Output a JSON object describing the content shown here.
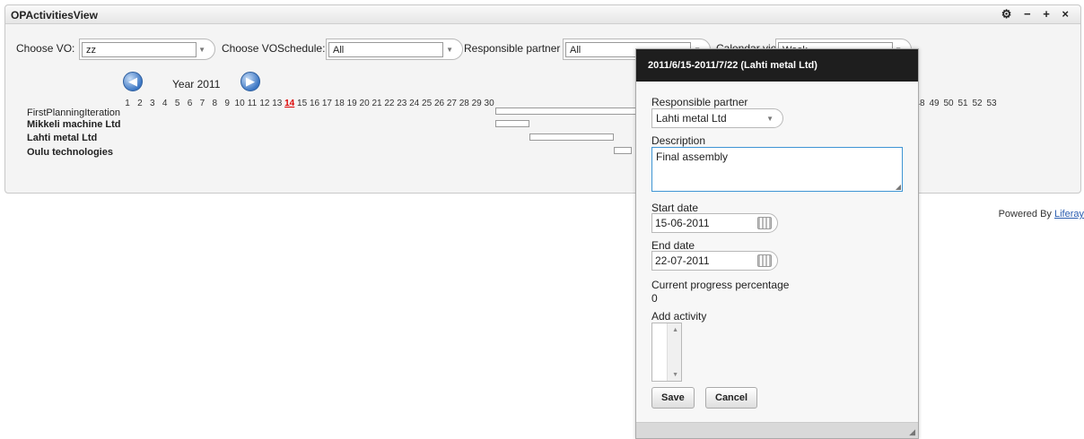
{
  "portlet": {
    "title": "OPActivitiesView",
    "controls": {
      "config": "⚙",
      "minimize": "−",
      "maximize": "+",
      "close": "×"
    }
  },
  "filters": {
    "vo": {
      "label": "Choose VO:",
      "value": "zz"
    },
    "schedule": {
      "label": "Choose VOSchedule:",
      "value": "All"
    },
    "partner": {
      "label": "Responsible partner",
      "value": "All"
    },
    "calendar": {
      "label": "Calendar view:",
      "value": "Week"
    }
  },
  "timeline": {
    "year_label": "Year 2011",
    "prev_label": "◀",
    "next_label": "▶",
    "current_week": 14,
    "weeks_left": [
      "1",
      "2",
      "3",
      "4",
      "5",
      "6",
      "7",
      "8",
      "9",
      "10",
      "11",
      "12",
      "13",
      "14",
      "15",
      "16",
      "17",
      "18",
      "19",
      "20",
      "21",
      "22",
      "23",
      "24",
      "25",
      "26",
      "27",
      "28",
      "29",
      "30"
    ],
    "weeks_right": [
      "48",
      "49",
      "50",
      "51",
      "52",
      "53"
    ],
    "rows": [
      {
        "label": "FirstPlanningIteration",
        "bold": false
      },
      {
        "label": "Mikkeli machine Ltd",
        "bold": true
      },
      {
        "label": "Lahti metal Ltd",
        "bold": true
      },
      {
        "label": "Oulu technologies",
        "bold": true
      }
    ]
  },
  "footer": {
    "prefix": "Powered By ",
    "link": "Liferay"
  },
  "dialog": {
    "title": "2011/6/15-2011/7/22 (Lahti metal Ltd)",
    "partner_label": "Responsible partner",
    "partner_value": "Lahti metal Ltd",
    "description_label": "Description",
    "description_value": "Final assembly",
    "start_label": "Start date",
    "start_value": "15-06-2011",
    "end_label": "End date",
    "end_value": "22-07-2011",
    "progress_label": "Current progress percentage",
    "progress_value": "0",
    "activity_label": "Add activity",
    "save_label": "Save",
    "cancel_label": "Cancel"
  }
}
